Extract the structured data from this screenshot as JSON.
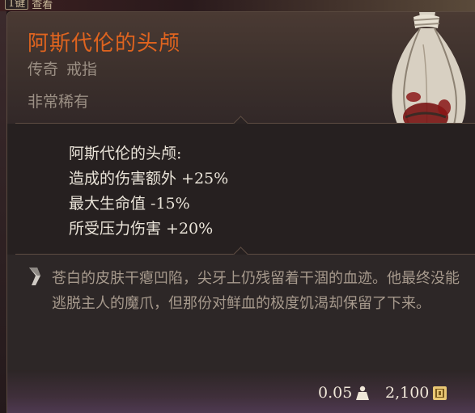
{
  "background": {
    "key_hint": {
      "key": "1键",
      "label": "查看"
    }
  },
  "tooltip": {
    "title": "阿斯代伦的头颅",
    "rarity": "传奇",
    "category": "戒指",
    "subtitle": "非常稀有",
    "colors": {
      "title": "#e0641f",
      "muted": "#9b8f84",
      "text": "#e9e3d8"
    },
    "item_icon": "severed-head-in-sack-icon",
    "effects": {
      "heading": "阿斯代伦的头颅:",
      "lines": [
        "造成的伤害额外 +25%",
        "最大生命值 -15%",
        "所受压力伤害 +20%"
      ]
    },
    "lore": {
      "icon": "quote-icon",
      "text": "苍白的皮肤干瘪凹陷，尖牙上仍残留着干涸的血迹。他最终没能逃脱主人的魔爪，但那份对鲜血的极度饥渴却保留了下来。"
    },
    "footer": {
      "weight": "0.05",
      "weight_icon": "weight-icon",
      "price": "2,100",
      "price_icon": "gold-coin-icon"
    }
  }
}
